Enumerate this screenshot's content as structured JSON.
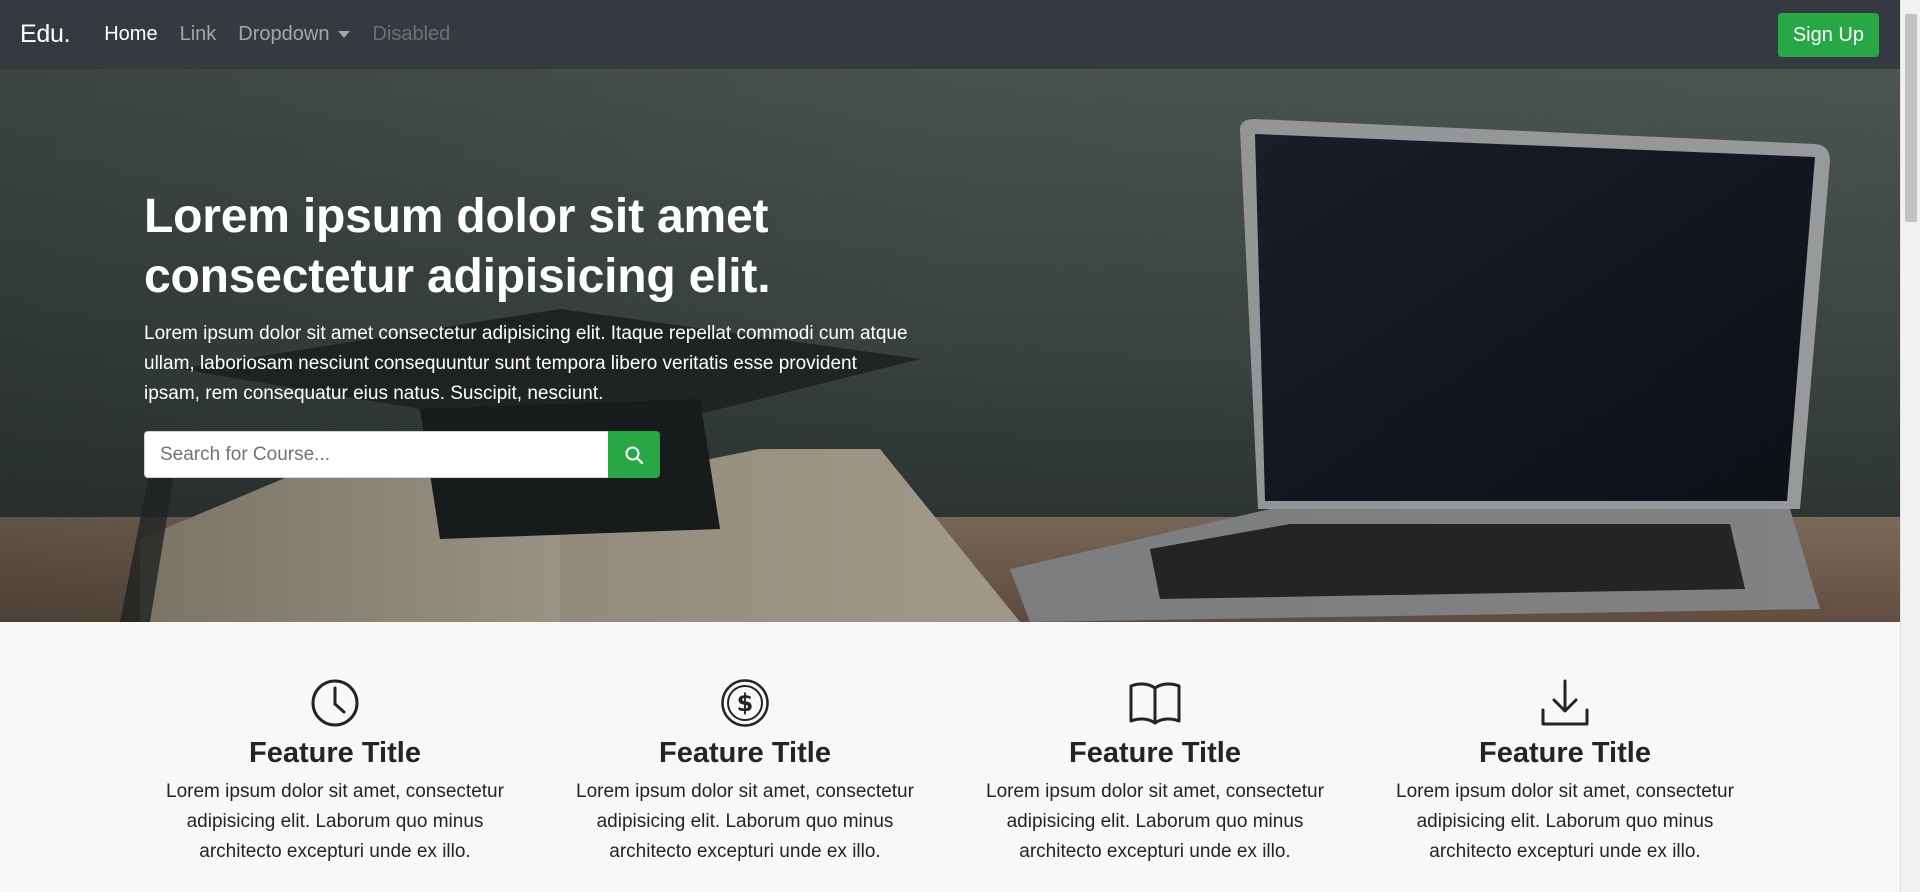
{
  "navbar": {
    "brand": "Edu.",
    "items": [
      {
        "label": "Home",
        "state": "active"
      },
      {
        "label": "Link",
        "state": "normal"
      },
      {
        "label": "Dropdown",
        "state": "dropdown"
      },
      {
        "label": "Disabled",
        "state": "disabled"
      }
    ],
    "signup_label": "Sign Up"
  },
  "hero": {
    "title_line1": "Lorem ipsum dolor sit amet",
    "title_line2": "consectetur adipisicing elit.",
    "text": "Lorem ipsum dolor sit amet consectetur adipisicing elit. Itaque repellat commodi cum atque ullam, laboriosam nesciunt consequuntur sunt tempora libero veritatis esse provident ipsam, rem consequatur eius natus. Suscipit, nesciunt.",
    "search_placeholder": "Search for Course...",
    "search_icon": "search-icon"
  },
  "features": [
    {
      "icon": "clock-icon",
      "title": "Feature Title",
      "text": "Lorem ipsum dolor sit amet, consectetur adipisicing elit. Laborum quo minus architecto excepturi unde ex illo."
    },
    {
      "icon": "dollar-coin-icon",
      "title": "Feature Title",
      "text": "Lorem ipsum dolor sit amet, consectetur adipisicing elit. Laborum quo minus architecto excepturi unde ex illo."
    },
    {
      "icon": "book-icon",
      "title": "Feature Title",
      "text": "Lorem ipsum dolor sit amet, consectetur adipisicing elit. Laborum quo minus architecto excepturi unde ex illo."
    },
    {
      "icon": "download-icon",
      "title": "Feature Title",
      "text": "Lorem ipsum dolor sit amet, consectetur adipisicing elit. Laborum quo minus architecto excepturi unde ex illo."
    }
  ],
  "colors": {
    "navbar_bg": "#343a40",
    "accent_green": "#28a745",
    "features_bg": "#f8f8f8"
  }
}
